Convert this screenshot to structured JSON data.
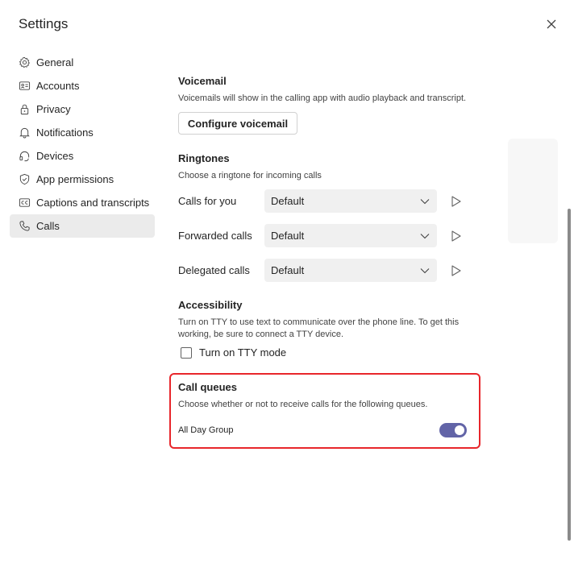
{
  "header": {
    "title": "Settings"
  },
  "sidebar": {
    "items": [
      {
        "label": "General",
        "icon": "gear-icon"
      },
      {
        "label": "Accounts",
        "icon": "id-card-icon"
      },
      {
        "label": "Privacy",
        "icon": "lock-icon"
      },
      {
        "label": "Notifications",
        "icon": "bell-icon"
      },
      {
        "label": "Devices",
        "icon": "headset-icon"
      },
      {
        "label": "App permissions",
        "icon": "shield-icon"
      },
      {
        "label": "Captions and transcripts",
        "icon": "cc-icon"
      },
      {
        "label": "Calls",
        "icon": "phone-icon",
        "active": true
      }
    ]
  },
  "voicemail": {
    "heading": "Voicemail",
    "description": "Voicemails will show in the calling app with audio playback and transcript.",
    "configure_label": "Configure voicemail"
  },
  "ringtones": {
    "heading": "Ringtones",
    "description": "Choose a ringtone for incoming calls",
    "rows": [
      {
        "label": "Calls for you",
        "value": "Default"
      },
      {
        "label": "Forwarded calls",
        "value": "Default"
      },
      {
        "label": "Delegated calls",
        "value": "Default"
      }
    ]
  },
  "accessibility": {
    "heading": "Accessibility",
    "description": "Turn on TTY to use text to communicate over the phone line. To get this working, be sure to connect a TTY device.",
    "tty_label": "Turn on TTY mode",
    "tty_checked": false
  },
  "call_queues": {
    "heading": "Call queues",
    "description": "Choose whether or not to receive calls for the following queues.",
    "queues": [
      {
        "label": "All Day Group",
        "enabled": true
      }
    ]
  },
  "colors": {
    "accent": "#6264a7",
    "highlight": "#e8262b"
  }
}
